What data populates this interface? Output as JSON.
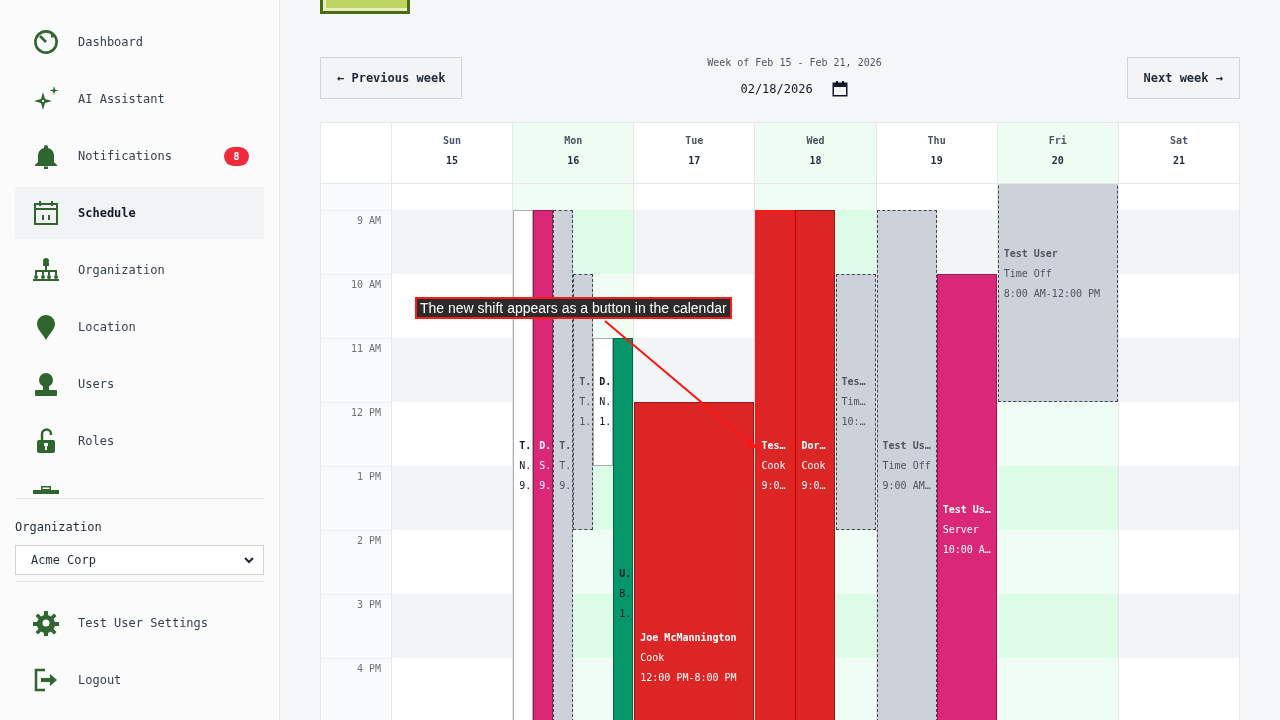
{
  "sidebar": {
    "items": [
      {
        "label": "Dashboard",
        "selected": false
      },
      {
        "label": "AI Assistant",
        "selected": false
      },
      {
        "label": "Notifications",
        "selected": false,
        "badge": "8"
      },
      {
        "label": "Schedule",
        "selected": true
      },
      {
        "label": "Organization",
        "selected": false
      },
      {
        "label": "Location",
        "selected": false
      },
      {
        "label": "Users",
        "selected": false
      },
      {
        "label": "Roles",
        "selected": false
      }
    ],
    "organization": {
      "label": "Organization",
      "value": "Acme Corp"
    },
    "footer_items": [
      {
        "label": "Test User Settings"
      },
      {
        "label": "Logout"
      }
    ]
  },
  "week_nav": {
    "previous": "← Previous week",
    "range": "Week of Feb 15 - Feb 21, 2026",
    "date": "02/18/2026",
    "next": "Next week →"
  },
  "calendar": {
    "days": [
      {
        "name": "Sun",
        "date": "15",
        "highlighted": false
      },
      {
        "name": "Mon",
        "date": "16",
        "highlighted": true,
        "events": [
          {
            "kind": "shift",
            "color": "#ffffff",
            "name": "T.",
            "role": "N.",
            "time": "9.",
            "highlighted": false
          },
          {
            "kind": "shift",
            "color": "#db2777",
            "name": "D.",
            "role": "S.",
            "time": "9.",
            "highlighted": false
          },
          {
            "kind": "time_off",
            "color": "#cdd1da",
            "name": "T.",
            "role": "T.",
            "time": "9.",
            "highlighted": false
          },
          {
            "kind": "time_off",
            "color": "#cdd1da",
            "name": "T.",
            "role": "T.",
            "time": "1.",
            "highlighted": false
          },
          {
            "kind": "shift",
            "color": "#ffffff",
            "name": "D.",
            "role": "N.",
            "time": "1.",
            "highlighted": false
          },
          {
            "kind": "shift",
            "color": "#059669",
            "name": "U.",
            "role": "B.",
            "time": "1.",
            "highlighted": false
          }
        ]
      },
      {
        "name": "Tue",
        "date": "17",
        "highlighted": false,
        "events": [
          {
            "kind": "shift",
            "color": "#dc2626",
            "name": "Joe McMannington",
            "role": "Cook",
            "time": "12:00 PM-8:00 PM",
            "highlighted": false
          }
        ]
      },
      {
        "name": "Wed",
        "date": "18",
        "highlighted": true,
        "events": [
          {
            "kind": "shift",
            "color": "#dc2626",
            "name": "Tes…",
            "role": "Cook",
            "time": "9:0…",
            "highlighted": true
          },
          {
            "kind": "shift",
            "color": "#dc2626",
            "name": "Dor…",
            "role": "Cook",
            "time": "9:0…",
            "highlighted": false
          },
          {
            "kind": "time_off",
            "color": "#cdd1da",
            "name": "Tes…",
            "role": "Tim…",
            "time": "10:…",
            "highlighted": false
          }
        ]
      },
      {
        "name": "Thu",
        "date": "19",
        "highlighted": false,
        "events": [
          {
            "kind": "time_off",
            "color": "#cdd1da",
            "name": "Test Us…",
            "role": "Time Off",
            "time": "9:00 AM…",
            "highlighted": false
          },
          {
            "kind": "shift",
            "color": "#db2777",
            "name": "Test Us…",
            "role": "Server",
            "time": "10:00 A…",
            "highlighted": false
          }
        ]
      },
      {
        "name": "Fri",
        "date": "20",
        "highlighted": true,
        "events": [
          {
            "kind": "time_off",
            "color": "#cdd1da",
            "name": "Test User",
            "role": "Time Off",
            "time": "8:00 AM-12:00 PM",
            "highlighted": false
          }
        ]
      },
      {
        "name": "Sat",
        "date": "21",
        "highlighted": false
      }
    ],
    "time_labels": [
      "9 AM",
      "10 AM",
      "11 AM",
      "12 PM",
      "1 PM",
      "2 PM",
      "3 PM",
      "4 PM"
    ]
  },
  "annotation": {
    "text": "The new shift appears as a button in the calendar"
  }
}
